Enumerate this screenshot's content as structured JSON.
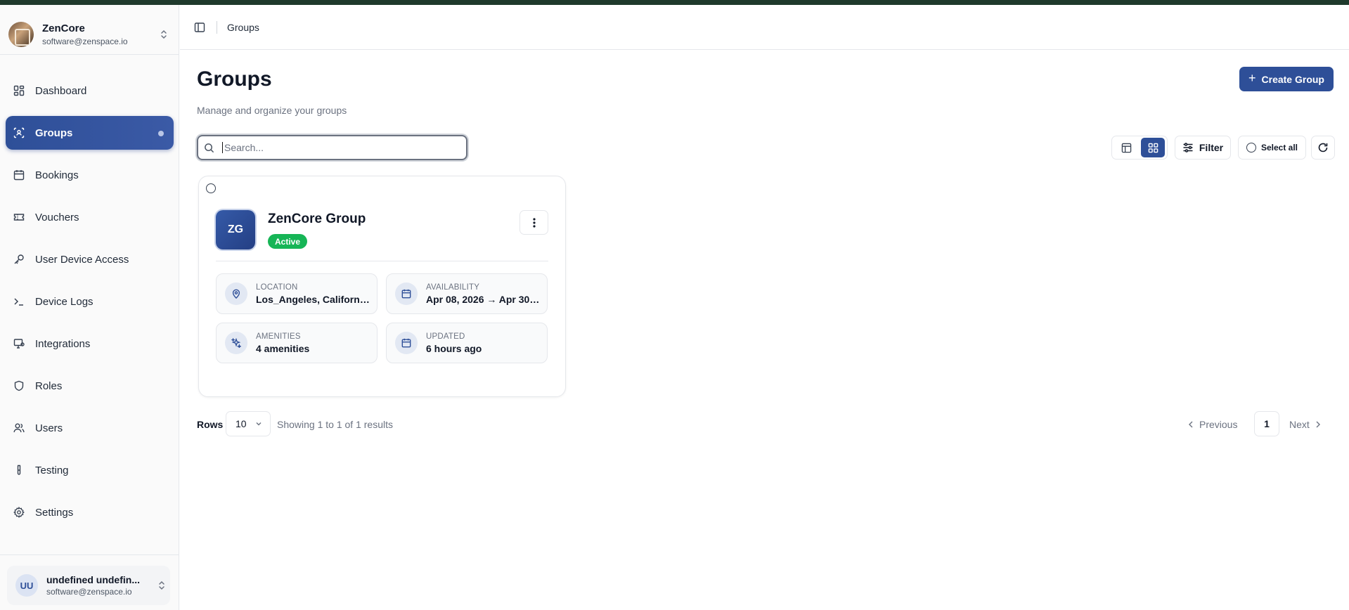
{
  "workspace": {
    "name": "ZenCore",
    "email": "software@zenspace.io"
  },
  "sidebar": {
    "items": [
      {
        "label": "Dashboard",
        "icon": "dashboard-icon"
      },
      {
        "label": "Groups",
        "icon": "groups-icon",
        "active": true
      },
      {
        "label": "Bookings",
        "icon": "calendar-icon"
      },
      {
        "label": "Vouchers",
        "icon": "ticket-icon"
      },
      {
        "label": "User Device Access",
        "icon": "key-icon"
      },
      {
        "label": "Device Logs",
        "icon": "terminal-icon"
      },
      {
        "label": "Integrations",
        "icon": "monitor-link-icon"
      },
      {
        "label": "Roles",
        "icon": "shield-icon"
      },
      {
        "label": "Users",
        "icon": "users-icon"
      },
      {
        "label": "Testing",
        "icon": "test-tube-icon"
      },
      {
        "label": "Settings",
        "icon": "gear-icon"
      }
    ]
  },
  "user": {
    "initials": "UU",
    "name": "undefined undefin...",
    "email": "software@zenspace.io"
  },
  "header": {
    "breadcrumb": "Groups"
  },
  "page": {
    "title": "Groups",
    "subtitle": "Manage and organize your groups",
    "create_label": "Create Group"
  },
  "search": {
    "placeholder": "Search...",
    "value": ""
  },
  "toolbar": {
    "filter_label": "Filter",
    "select_all_label": "Select all",
    "view_mode": "grid"
  },
  "group_card": {
    "initials": "ZG",
    "name": "ZenCore Group",
    "status": "Active",
    "location_label": "LOCATION",
    "location_value": "Los_Angeles, California...",
    "availability_label": "AVAILABILITY",
    "availability_value": "Apr 08, 2026 → Apr 30,...",
    "amenities_label": "AMENITIES",
    "amenities_value": "4 amenities",
    "updated_label": "UPDATED",
    "updated_value": "6 hours ago"
  },
  "pagination": {
    "rows_label": "Rows",
    "rows_value": "10",
    "showing": "Showing 1 to 1 of 1 results",
    "previous": "Previous",
    "current_page": "1",
    "next": "Next"
  },
  "colors": {
    "accent": "#2e4f98",
    "status_active": "#16b556",
    "top_strip": "#1f3a2c"
  }
}
